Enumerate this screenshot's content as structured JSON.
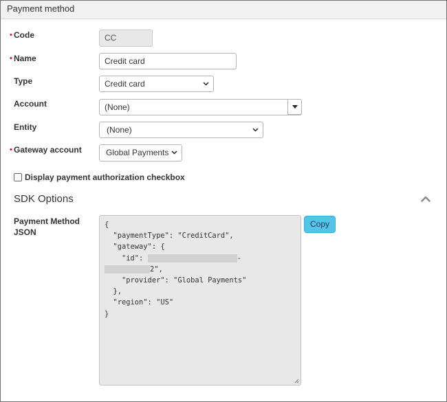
{
  "header": {
    "title": "Payment method"
  },
  "form": {
    "code": {
      "label": "Code",
      "value": "CC"
    },
    "name": {
      "label": "Name",
      "value": "Credit card"
    },
    "type": {
      "label": "Type",
      "value": "Credit card"
    },
    "account": {
      "label": "Account",
      "value": "(None)"
    },
    "entity": {
      "label": "Entity",
      "value": "(None)"
    },
    "gateway_account": {
      "label": "Gateway account",
      "value": "Global Payments"
    },
    "display_auth": {
      "label": "Display payment authorization checkbox",
      "checked": false
    }
  },
  "sdk": {
    "title": "SDK Options",
    "json_label_line1": "Payment Method",
    "json_label_line2": "JSON",
    "json_lines": [
      "{",
      "  \"paymentType\": \"CreditCard\",",
      "  \"gateway\": {",
      "    \"id\": ",
      "",
      "    \"provider\": \"Global Payments\"",
      "  },",
      "  \"region\": \"US\"",
      "}"
    ],
    "id_tail": "-",
    "id_line2_tail": "2\",",
    "copy_label": "Copy"
  },
  "colors": {
    "required": "#d0021b",
    "copy_button": "#55c3ec",
    "header_bg": "#f2f2f2"
  },
  "icons": {
    "collapse": "chevron-up-icon",
    "select": "chevron-down-icon"
  }
}
